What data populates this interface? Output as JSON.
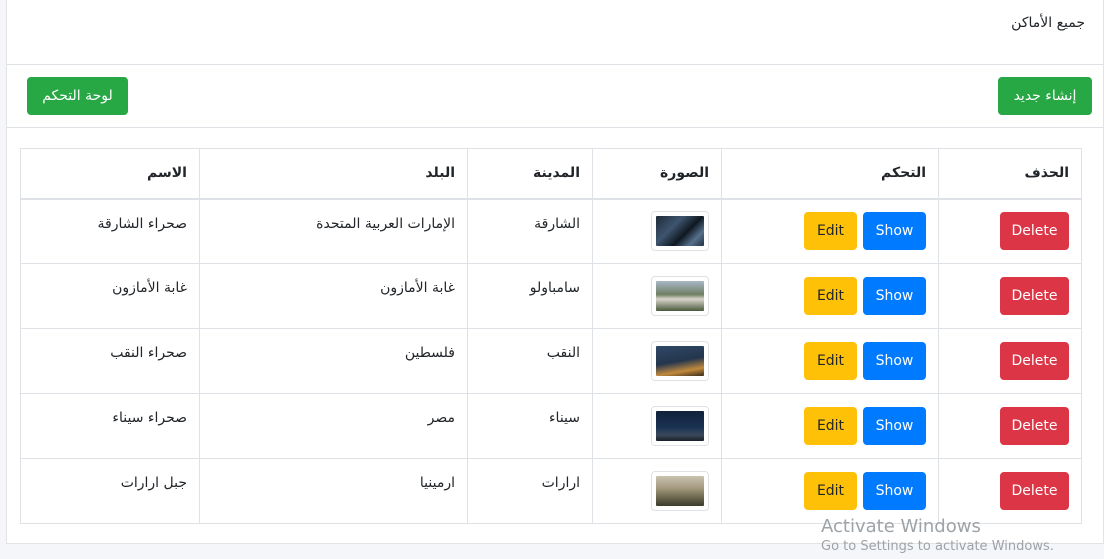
{
  "header": {
    "title": "جميع الأماكن"
  },
  "toolbar": {
    "create_label": "إنشاء جديد",
    "dashboard_label": "لوحة التحكم"
  },
  "table": {
    "columns": [
      "الاسم",
      "البلد",
      "المدينة",
      "الصورة",
      "التحكم",
      "الحذف"
    ],
    "show_label": "Show",
    "edit_label": "Edit",
    "delete_label": "Delete",
    "rows": [
      {
        "name": "صحراء الشارقة",
        "country": "الإمارات العربية المتحدة",
        "city": "الشارقة"
      },
      {
        "name": "غابة الأمازون",
        "country": "غابة الأمازون",
        "city": "سامباولو"
      },
      {
        "name": "صحراء النقب",
        "country": "فلسطين",
        "city": "النقب"
      },
      {
        "name": "صحراء سيناء",
        "country": "مصر",
        "city": "سيناء"
      },
      {
        "name": "جبل ارارات",
        "country": "ارمينيا",
        "city": "ارارات"
      }
    ]
  },
  "watermark": {
    "line1": "Activate Windows",
    "line2": "Go to Settings to activate Windows."
  },
  "colors": {
    "primary": "#007bff",
    "success": "#28a745",
    "warning": "#ffc107",
    "danger": "#dc3545"
  }
}
